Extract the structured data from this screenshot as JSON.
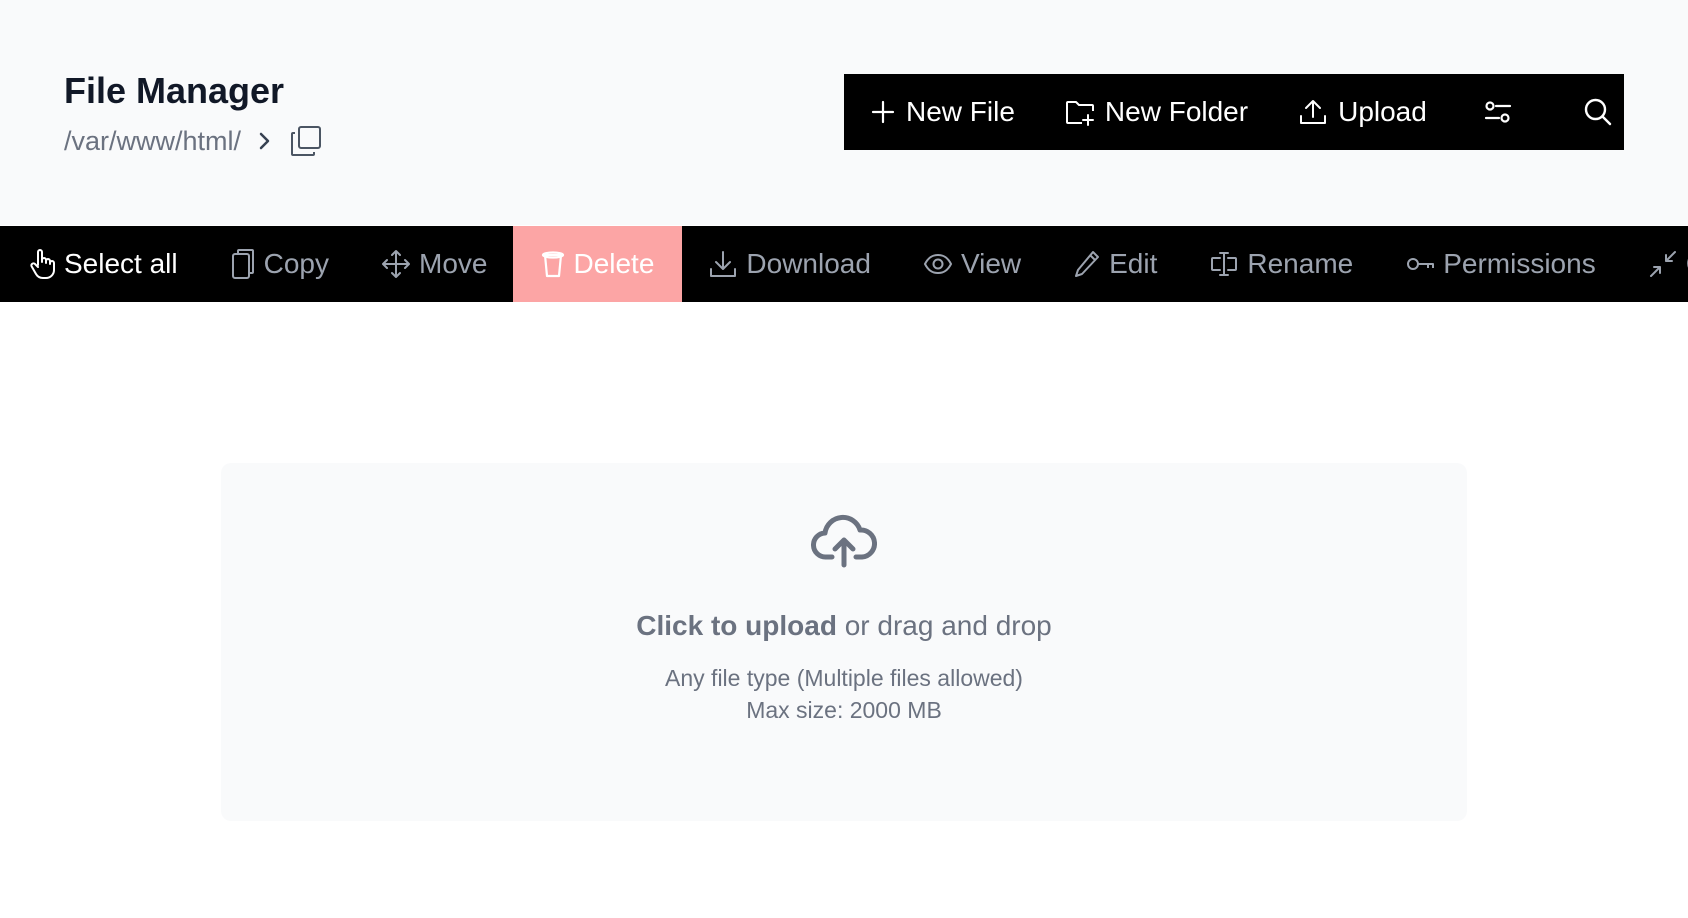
{
  "header": {
    "title": "File Manager",
    "path": "/var/www/html/"
  },
  "top_actions": {
    "new_file": "New File",
    "new_folder": "New Folder",
    "upload": "Upload"
  },
  "toolbar": {
    "select_all": "Select all",
    "copy": "Copy",
    "move": "Move",
    "delete": "Delete",
    "download": "Download",
    "view": "View",
    "edit": "Edit",
    "rename": "Rename",
    "permissions": "Permissions",
    "cut_partial": "C"
  },
  "dropzone": {
    "click_label": "Click to upload",
    "drag_label": " or drag and drop",
    "file_types": "Any file type (Multiple files allowed)",
    "max_size": "Max size: 2000 MB"
  },
  "colors": {
    "toolbar_bg": "#000000",
    "delete_bg": "#fca5a5",
    "header_bg": "#f9fafb",
    "muted_text": "#6b7280",
    "inactive_tool": "#9ca3af"
  },
  "icons": [
    "copy-path-icon",
    "chevron-right-icon",
    "plus-icon",
    "folder-plus-icon",
    "upload-icon",
    "filter-icon",
    "search-icon",
    "hand-pointer-icon",
    "copy-icon",
    "move-icon",
    "trash-icon",
    "download-icon",
    "eye-icon",
    "pencil-icon",
    "rename-icon",
    "key-icon",
    "compress-icon",
    "cloud-upload-icon"
  ]
}
